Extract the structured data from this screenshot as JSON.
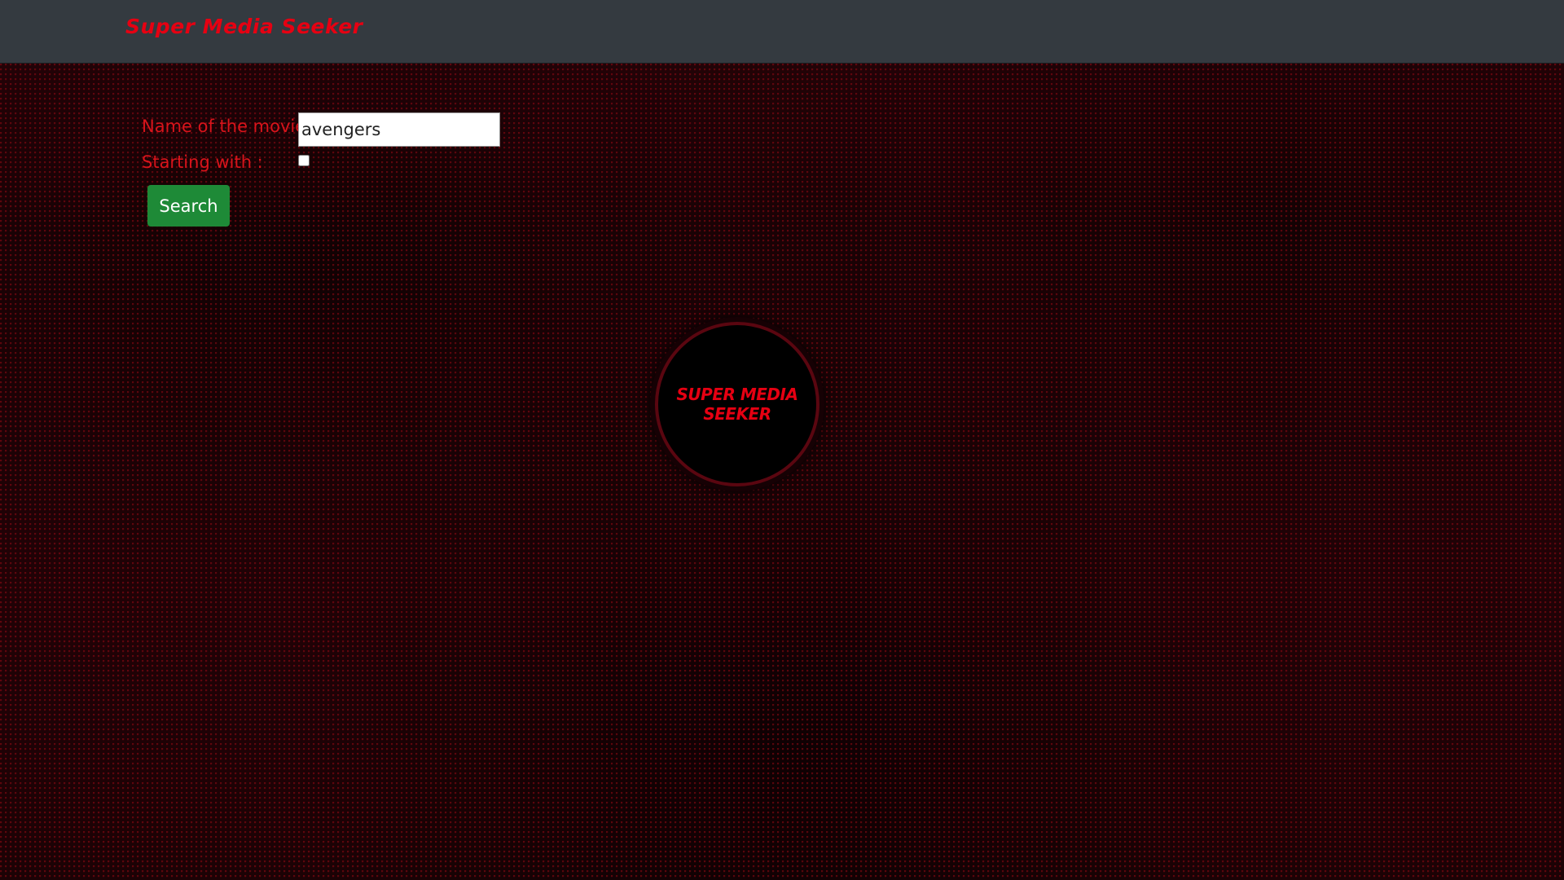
{
  "navbar": {
    "brand": "Super Media Seeker",
    "background_color": "#343a40",
    "brand_color": "#e60012"
  },
  "search_form": {
    "movie_label": "Name of the movie",
    "movie_value": "avengers",
    "starting_with_label": "Starting with :",
    "starting_with_checked": false,
    "search_button_label": "Search",
    "button_color": "#1e8a37",
    "label_color": "#d8141b"
  },
  "logo": {
    "text": "Super Media Seeker",
    "icon": "logo-emblem"
  }
}
